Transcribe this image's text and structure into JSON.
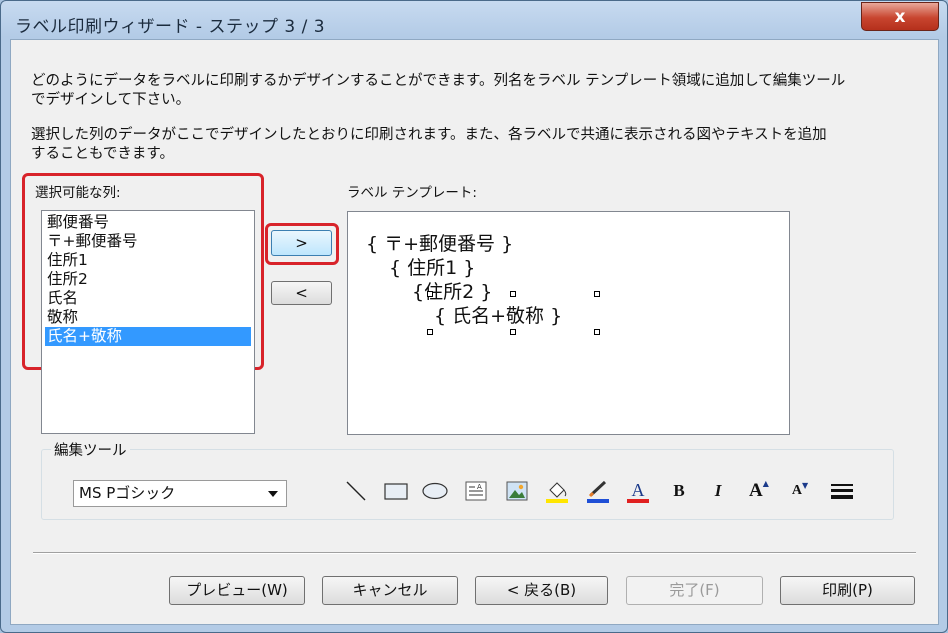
{
  "window": {
    "title": "ラベル印刷ウィザード - ステップ 3 / 3",
    "close_label": "x"
  },
  "description": {
    "line1": "どのようにデータをラベルに印刷するかデザインすることができます。列名をラベル テンプレート領域に追加して編集ツール",
    "line2": "でデザインして下さい。",
    "line3": "選択した列のデータがここでデザインしたとおりに印刷されます。また、各ラベルで共通に表示される図やテキストを追加",
    "line4": "することもできます。"
  },
  "columns": {
    "label": "選択可能な列:",
    "items": [
      "郵便番号",
      "〒+郵便番号",
      "住所1",
      "住所2",
      "氏名",
      "敬称",
      "氏名+敬称"
    ],
    "selected_index": 6
  },
  "add_button_label": ">",
  "remove_button_label": "<",
  "template": {
    "label": "ラベル テンプレート:",
    "lines": [
      "{ 〒+郵便番号 }",
      "{ 住所1 }",
      "{住所2 }",
      "{ 氏名+敬称 }"
    ]
  },
  "tools": {
    "group_label": "編集ツール",
    "font_value": "MS Pゴシック",
    "icons": [
      "line-icon",
      "rectangle-icon",
      "ellipse-icon",
      "text-box-icon",
      "image-icon",
      "fill-color-icon",
      "line-color-icon",
      "font-color-icon",
      "bold-icon",
      "italic-icon",
      "font-grow-icon",
      "font-shrink-icon",
      "line-weight-icon"
    ],
    "bold_glyph": "B",
    "italic_glyph": "I",
    "font_color_glyph": "A",
    "grow_glyph": "A",
    "shrink_glyph": "A"
  },
  "buttons": {
    "preview": "プレビュー(W)",
    "cancel": "キャンセル",
    "back": "< 戻る(B)",
    "finish": "完了(F)",
    "print": "印刷(P)"
  },
  "colors": {
    "accent_red": "#d8232a",
    "selection": "#3399ff",
    "fill_yellow": "#ffe600",
    "line_blue": "#1f4fd6",
    "font_red": "#e02020"
  }
}
